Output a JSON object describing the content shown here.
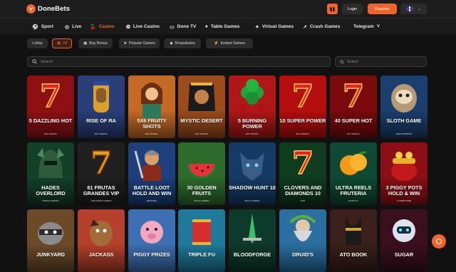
{
  "brand": {
    "name": "DoneBets"
  },
  "header": {
    "login_label": "Login",
    "register_label": "Register"
  },
  "nav": [
    {
      "label": "Sport",
      "icon": "soccer-ball-icon",
      "active": false
    },
    {
      "label": "Live",
      "icon": "live-broadcast-icon",
      "active": false
    },
    {
      "label": "Casino",
      "icon": "cherries-icon",
      "active": true
    },
    {
      "label": "Live Casino",
      "icon": "roulette-icon",
      "active": false
    },
    {
      "label": "Done TV",
      "icon": "tv-icon",
      "active": false
    },
    {
      "label": "Table Games",
      "icon": "cards-icon",
      "active": false
    },
    {
      "label": "Virtual Games",
      "icon": "virtual-icon",
      "active": false
    },
    {
      "label": "Crash Games",
      "icon": "rocket-icon",
      "active": false
    },
    {
      "label": "Telegram",
      "icon": "chevron-down-icon",
      "active": false
    }
  ],
  "filters": [
    {
      "label": "Lobby",
      "active": false
    },
    {
      "label": "All",
      "active": true
    },
    {
      "label": "Buy Bonus",
      "active": false
    },
    {
      "label": "Popular Games",
      "active": false
    },
    {
      "label": "Drops&wins",
      "active": false
    },
    {
      "label": "Instant Games",
      "active": false
    }
  ],
  "search": {
    "placeholder": "Search"
  },
  "provider_select": {
    "placeholder": "Select"
  },
  "games": [
    {
      "title": "5 Dazzling Hot",
      "provider": "EGT DIGITAL",
      "bg": "#8e1013",
      "art": "seven"
    },
    {
      "title": "Rise of Ra",
      "provider": "EGT DIGITAL",
      "bg": "#2a3f7a",
      "art": "pharaoh"
    },
    {
      "title": "5x6 Fruity Shots",
      "provider": "EGT DIGITAL",
      "bg": "#c46a24",
      "art": "girl"
    },
    {
      "title": "Mystic Desert",
      "provider": "EGT DIGITAL",
      "bg": "#9b4b1c",
      "art": "queen"
    },
    {
      "title": "5 Burning Power",
      "provider": "EGT DIGITAL",
      "bg": "#b01717",
      "art": "clover"
    },
    {
      "title": "10 Super Power",
      "provider": "EGT DIGITAL",
      "bg": "#b50e0e",
      "art": "seven"
    },
    {
      "title": "40 Super Hot",
      "provider": "EGT DIGITAL",
      "bg": "#7a0a0c",
      "art": "seven"
    },
    {
      "title": "Sloth Game",
      "provider": "SMOOTHPIPRA",
      "bg": "#1b3f6e",
      "art": "sloth"
    },
    {
      "title": "Hades Overlord",
      "provider": "TRIPLE CHERRY",
      "bg": "#14402a",
      "art": "helmet"
    },
    {
      "title": "81 Frutas Grandes VIP",
      "provider": "TOM HORN GAMING",
      "bg": "#1f1f1f",
      "art": "seven-dark"
    },
    {
      "title": "Battle Loot Hold and Win",
      "provider": "BGAMING",
      "bg": "#1d3f7c",
      "art": "warrior"
    },
    {
      "title": "30 Golden Fruits",
      "provider": "FELIX GAMING",
      "bg": "#2d6b2c",
      "art": "melon"
    },
    {
      "title": "Shadow Hunt 10",
      "provider": "FELIX GAMING",
      "bg": "#153a66",
      "art": "wolf"
    },
    {
      "title": "Clovers and Diamonds 10",
      "provider": "FAZI",
      "bg": "#0f3b1e",
      "art": "seven"
    },
    {
      "title": "Ultra Reels Fruteria",
      "provider": "EVOPLAY",
      "bg": "#0e4a33",
      "art": "orange"
    },
    {
      "title": "3 Piggy Pots Hold & Win",
      "provider": "CLAWBUSTER",
      "bg": "#8b0f14",
      "art": "pot"
    },
    {
      "title": "Junkyard",
      "provider": "",
      "bg": "#6b4a2a",
      "art": "raccoon"
    },
    {
      "title": "Jackass",
      "provider": "",
      "bg": "#b5402b",
      "art": "horse"
    },
    {
      "title": "Piggy Prizes",
      "provider": "",
      "bg": "#3d6fb3",
      "art": "pig"
    },
    {
      "title": "Triple Fu",
      "provider": "",
      "bg": "#1e7a9a",
      "art": "lantern"
    },
    {
      "title": "Bloodforge",
      "provider": "",
      "bg": "#0e3a2b",
      "art": "sword"
    },
    {
      "title": "Druid's",
      "provider": "",
      "bg": "#2a6fa0",
      "art": "druid"
    },
    {
      "title": "Ato Book",
      "provider": "",
      "bg": "#3a1f1a",
      "art": "anubis"
    },
    {
      "title": "Sugar",
      "provider": "",
      "bg": "#3a0f1e",
      "art": "robot"
    }
  ],
  "colors": {
    "accent": "#f0632a",
    "bg": "#111111",
    "bar": "#1c1c1c"
  }
}
